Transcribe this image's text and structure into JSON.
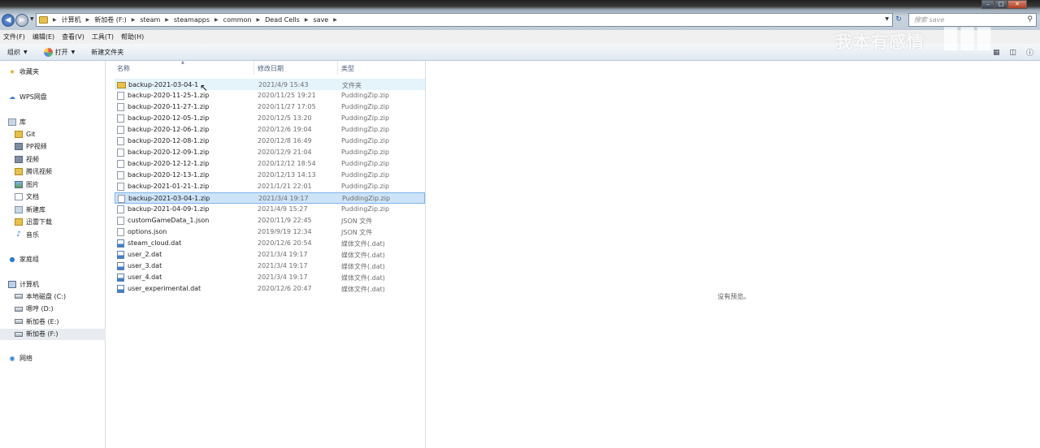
{
  "address": {
    "crumbs": [
      "计算机",
      "新加卷 (F:)",
      "steam",
      "steamapps",
      "common",
      "Dead Cells",
      "save"
    ]
  },
  "search": {
    "placeholder": "搜索 save"
  },
  "watermark": {
    "text": "我本有感情"
  },
  "menu": [
    "文件(F)",
    "编辑(E)",
    "查看(V)",
    "工具(T)",
    "帮助(H)"
  ],
  "toolbar": {
    "organize": "组织",
    "open": "打开",
    "new_folder": "新建文件夹"
  },
  "nav": {
    "favorites": "收藏夹",
    "wps": "WPS网盘",
    "library": "库",
    "library_items": [
      "Git",
      "PP视频",
      "视频",
      "腾讯视频",
      "图片",
      "文档",
      "新建库",
      "迅雷下载",
      "音乐"
    ],
    "homegroup": "家庭组",
    "computer": "计算机",
    "drives": [
      "本地磁盘 (C:)",
      "嗯哼 (D:)",
      "新加卷 (E:)",
      "新加卷 (F:)"
    ],
    "network": "网络"
  },
  "columns": {
    "name": "名称",
    "date": "修改日期",
    "type": "类型"
  },
  "files": [
    {
      "name": "backup-2021-03-04-1",
      "date": "2021/4/9 15:43",
      "type": "文件夹",
      "kind": "folder"
    },
    {
      "name": "backup-2020-11-25-1.zip",
      "date": "2020/11/25 19:21",
      "type": "PuddingZip.zip",
      "kind": "zip"
    },
    {
      "name": "backup-2020-11-27-1.zip",
      "date": "2020/11/27 17:05",
      "type": "PuddingZip.zip",
      "kind": "zip"
    },
    {
      "name": "backup-2020-12-05-1.zip",
      "date": "2020/12/5 13:20",
      "type": "PuddingZip.zip",
      "kind": "zip"
    },
    {
      "name": "backup-2020-12-06-1.zip",
      "date": "2020/12/6 19:04",
      "type": "PuddingZip.zip",
      "kind": "zip"
    },
    {
      "name": "backup-2020-12-08-1.zip",
      "date": "2020/12/8 16:49",
      "type": "PuddingZip.zip",
      "kind": "zip"
    },
    {
      "name": "backup-2020-12-09-1.zip",
      "date": "2020/12/9 21:04",
      "type": "PuddingZip.zip",
      "kind": "zip"
    },
    {
      "name": "backup-2020-12-12-1.zip",
      "date": "2020/12/12 18:54",
      "type": "PuddingZip.zip",
      "kind": "zip"
    },
    {
      "name": "backup-2020-12-13-1.zip",
      "date": "2020/12/13 14:13",
      "type": "PuddingZip.zip",
      "kind": "zip"
    },
    {
      "name": "backup-2021-01-21-1.zip",
      "date": "2021/1/21 22:01",
      "type": "PuddingZip.zip",
      "kind": "zip"
    },
    {
      "name": "backup-2021-03-04-1.zip",
      "date": "2021/3/4 19:17",
      "type": "PuddingZip.zip",
      "kind": "zip"
    },
    {
      "name": "backup-2021-04-09-1.zip",
      "date": "2021/4/9 15:27",
      "type": "PuddingZip.zip",
      "kind": "zip"
    },
    {
      "name": "customGameData_1.json",
      "date": "2020/11/9 22:45",
      "type": "JSON 文件",
      "kind": "json"
    },
    {
      "name": "options.json",
      "date": "2019/9/19 12:34",
      "type": "JSON 文件",
      "kind": "json"
    },
    {
      "name": "steam_cloud.dat",
      "date": "2020/12/6 20:54",
      "type": "媒体文件(.dat)",
      "kind": "dat"
    },
    {
      "name": "user_2.dat",
      "date": "2021/3/4 19:17",
      "type": "媒体文件(.dat)",
      "kind": "dat"
    },
    {
      "name": "user_3.dat",
      "date": "2021/3/4 19:17",
      "type": "媒体文件(.dat)",
      "kind": "dat"
    },
    {
      "name": "user_4.dat",
      "date": "2021/3/4 19:17",
      "type": "媒体文件(.dat)",
      "kind": "dat"
    },
    {
      "name": "user_experimental.dat",
      "date": "2020/12/6 20:47",
      "type": "媒体文件(.dat)",
      "kind": "dat"
    }
  ],
  "selected_file": "backup-2021-03-04-1.zip",
  "hovered_file": "backup-2021-03-04-1",
  "preview": {
    "text": "没有预览。"
  }
}
